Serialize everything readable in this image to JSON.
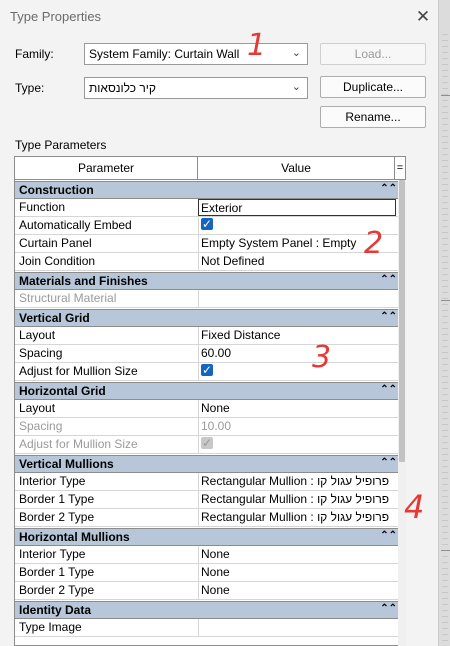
{
  "window": {
    "title": "Type Properties",
    "close_icon": "close-icon"
  },
  "family": {
    "label": "Family:",
    "value": "System Family: Curtain Wall"
  },
  "type": {
    "label": "Type:",
    "value": "קיר כלונסאות"
  },
  "buttons": {
    "load": "Load...",
    "duplicate": "Duplicate...",
    "rename": "Rename..."
  },
  "section_label": "Type Parameters",
  "grid": {
    "col_parameter": "Parameter",
    "col_value": "Value",
    "col_toggle": "=",
    "collapse_glyph": "⌃⌃",
    "categories": [
      {
        "name": "Construction",
        "rows": [
          {
            "param": "Function",
            "value": "Exterior",
            "kind": "text",
            "focused": true
          },
          {
            "param": "Automatically Embed",
            "value": "",
            "kind": "checkbox",
            "checked": true
          },
          {
            "param": "Curtain Panel",
            "value": "Empty System Panel : Empty",
            "kind": "text"
          },
          {
            "param": "Join Condition",
            "value": "Not Defined",
            "kind": "text"
          }
        ]
      },
      {
        "name": "Materials and Finishes",
        "rows": [
          {
            "param": "Structural Material",
            "value": "",
            "kind": "text",
            "disabled": true
          }
        ]
      },
      {
        "name": "Vertical Grid",
        "rows": [
          {
            "param": "Layout",
            "value": "Fixed Distance",
            "kind": "text"
          },
          {
            "param": "Spacing",
            "value": "60.00",
            "kind": "text"
          },
          {
            "param": "Adjust for Mullion Size",
            "value": "",
            "kind": "checkbox",
            "checked": true
          }
        ]
      },
      {
        "name": "Horizontal Grid",
        "rows": [
          {
            "param": "Layout",
            "value": "None",
            "kind": "text"
          },
          {
            "param": "Spacing",
            "value": "10.00",
            "kind": "text",
            "disabled": true
          },
          {
            "param": "Adjust for Mullion Size",
            "value": "",
            "kind": "checkbox",
            "checked": true,
            "disabled": true
          }
        ]
      },
      {
        "name": "Vertical Mullions",
        "rows": [
          {
            "param": "Interior Type",
            "value": "Rectangular Mullion : פרופיל עגול קו",
            "kind": "text"
          },
          {
            "param": "Border 1 Type",
            "value": "Rectangular Mullion : פרופיל עגול קו",
            "kind": "text"
          },
          {
            "param": "Border 2 Type",
            "value": "Rectangular Mullion : פרופיל עגול קו",
            "kind": "text"
          }
        ]
      },
      {
        "name": "Horizontal Mullions",
        "rows": [
          {
            "param": "Interior Type",
            "value": "None",
            "kind": "text"
          },
          {
            "param": "Border 1 Type",
            "value": "None",
            "kind": "text"
          },
          {
            "param": "Border 2 Type",
            "value": "None",
            "kind": "text"
          }
        ]
      },
      {
        "name": "Identity Data",
        "rows": [
          {
            "param": "Type Image",
            "value": "",
            "kind": "text"
          }
        ]
      }
    ]
  },
  "annotations": [
    "1",
    "2",
    "3",
    "4"
  ],
  "colors": {
    "category_bg": "#b7c7d9",
    "checkbox": "#1565c0",
    "annotation": "#e53935"
  }
}
